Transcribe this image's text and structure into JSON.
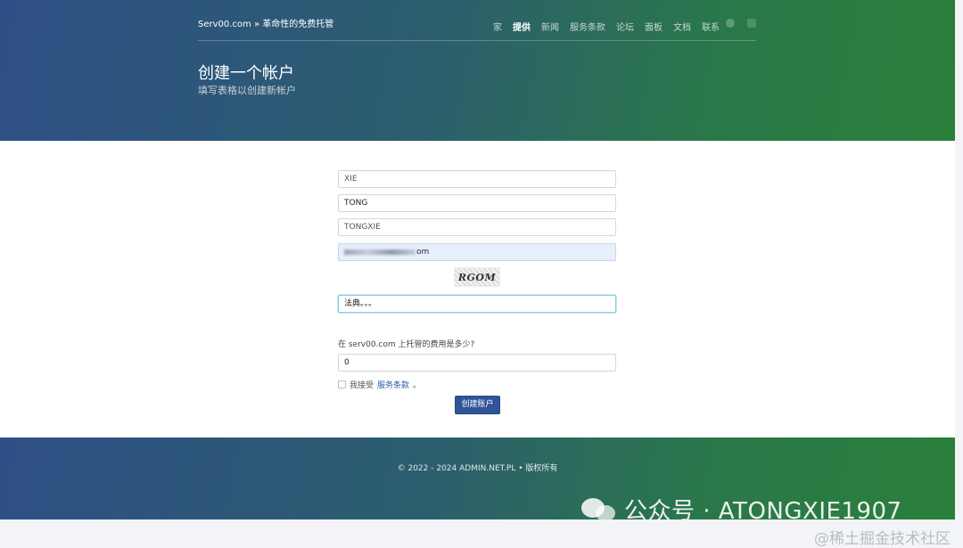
{
  "header": {
    "brand": "Serv00.com » 革命性的免费托管",
    "nav": [
      {
        "label": "家",
        "active": false
      },
      {
        "label": "提供",
        "active": true
      },
      {
        "label": "新闻",
        "active": false
      },
      {
        "label": "服务条款",
        "active": false
      },
      {
        "label": "论坛",
        "active": false
      },
      {
        "label": "面板",
        "active": false
      },
      {
        "label": "文档",
        "active": false
      },
      {
        "label": "联系",
        "active": false
      }
    ],
    "social": [
      "facebook-icon",
      "twitter-icon"
    ],
    "title": "创建一个帐户",
    "subtitle": "填写表格以创建新帐户"
  },
  "form": {
    "first_name": "XIE",
    "last_name": "TONG",
    "username": "TONGXIE",
    "email_suffix": "om",
    "captcha_text": "RGOM",
    "captcha_input": "法典。。。",
    "question": "在 serv00.com 上托管的费用是多少?",
    "answer": "0",
    "terms_prefix": "我接受",
    "terms_link": "服务条款",
    "terms_suffix": "。",
    "terms_checked": false,
    "submit_label": "创建账户"
  },
  "footer": {
    "copyright": "© 2022 - 2024 ADMIN.NET.PL • 版权所有"
  },
  "watermarks": {
    "wechat": "公众号 · ATONGXIE1907",
    "juejin": "@稀土掘金技术社区"
  },
  "colors": {
    "gradient_start": "#2e4f86",
    "gradient_end": "#2a7f3a",
    "button": "#2f5597",
    "link": "#2e5aa8"
  }
}
